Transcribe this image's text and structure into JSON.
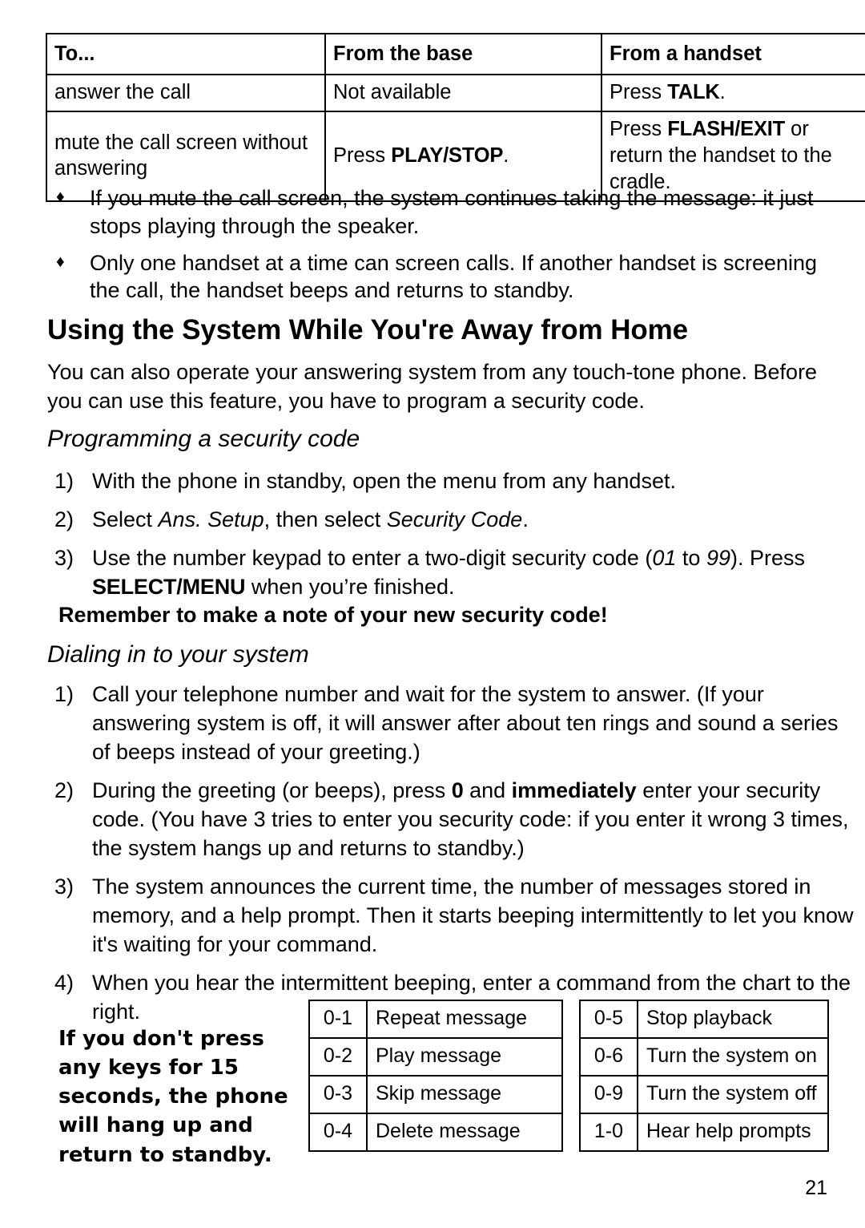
{
  "comparison_table": {
    "headers": [
      "To...",
      "From the base",
      "From a handset"
    ],
    "rows": [
      {
        "task": "answer the call",
        "from_base": "Not available",
        "from_handset_prefix": "Press ",
        "from_handset_key": "TALK",
        "from_handset_suffix": "."
      },
      {
        "task": "mute the call screen without answering",
        "from_base_prefix": "Press ",
        "from_base_key": "PLAY/STOP",
        "from_base_suffix": ".",
        "from_handset_prefix": "Press ",
        "from_handset_key": "FLASH/EXIT",
        "from_handset_suffix": " or return the handset to the cradle."
      }
    ]
  },
  "bullets": {
    "marker": "diamond-bullet",
    "marker_glyph": "♦",
    "items": [
      "If you mute the call screen, the system continues taking the message: it just stops playing through the speaker.",
      "Only one handset at a time can screen calls. If another handset is screening the call, the handset beeps and returns to standby."
    ]
  },
  "section": {
    "heading": "Using the System While You're Away from Home",
    "intro": "You can also operate your answering system from any touch-tone phone. Before you can use this feature, you have to program a security code."
  },
  "programming": {
    "heading": "Programming a security code",
    "steps": [
      {
        "number": "1)",
        "parts": [
          {
            "text": "With the phone in standby, open the menu from any handset.",
            "style": "normal"
          }
        ]
      },
      {
        "number": "2)",
        "parts": [
          {
            "text": "Select ",
            "style": "normal"
          },
          {
            "text": "Ans. Setup",
            "style": "italic"
          },
          {
            "text": ", then select ",
            "style": "normal"
          },
          {
            "text": "Security Code",
            "style": "italic"
          },
          {
            "text": ".",
            "style": "normal"
          }
        ]
      },
      {
        "number": "3)",
        "parts": [
          {
            "text": "Use the number keypad to enter a two-digit security code (",
            "style": "normal"
          },
          {
            "text": "01",
            "style": "italic"
          },
          {
            "text": " to ",
            "style": "normal"
          },
          {
            "text": "99",
            "style": "italic"
          },
          {
            "text": "). Press ",
            "style": "normal"
          },
          {
            "text": "SELECT/MENU",
            "style": "keycap"
          },
          {
            "text": " when you’re finished.",
            "style": "normal"
          }
        ]
      }
    ],
    "note": "Remember to make a note of your new security code!"
  },
  "dialing": {
    "heading": "Dialing in to your system",
    "steps": [
      {
        "number": "1)",
        "parts": [
          {
            "text": "Call your telephone number and wait for the system to answer. (If your answering system is off, it will answer after about ten rings and sound a series of beeps instead of your greeting.)",
            "style": "normal"
          }
        ]
      },
      {
        "number": "2)",
        "parts": [
          {
            "text": "During the greeting (or beeps), press ",
            "style": "normal"
          },
          {
            "text": "0",
            "style": "keycap"
          },
          {
            "text": " and ",
            "style": "normal"
          },
          {
            "text": "immediately",
            "style": "bold"
          },
          {
            "text": " enter your security code. (You have 3 tries to enter you security code: if you enter it wrong 3 times, the system hangs up and returns to standby.)",
            "style": "normal"
          }
        ]
      },
      {
        "number": "3)",
        "parts": [
          {
            "text": "The system announces the current time, the number of messages stored in memory, and a help prompt. Then it starts beeping intermittently to let you know it's waiting for your command.",
            "style": "normal"
          }
        ]
      },
      {
        "number": "4)",
        "parts": [
          {
            "text": "When you hear the intermittent beeping, enter a command from the chart to the right.",
            "style": "normal"
          }
        ]
      }
    ]
  },
  "side_note": "If you don't press any keys for 15 seconds, the phone will hang up and return to standby.",
  "command_table_left": {
    "rows": [
      {
        "code": "0-1",
        "action": "Repeat message"
      },
      {
        "code": "0-2",
        "action": "Play message"
      },
      {
        "code": "0-3",
        "action": "Skip message"
      },
      {
        "code": "0-4",
        "action": "Delete message"
      }
    ]
  },
  "command_table_right": {
    "rows": [
      {
        "code": "0-5",
        "action": "Stop playback"
      },
      {
        "code": "0-6",
        "action": "Turn the system on"
      },
      {
        "code": "0-9",
        "action": "Turn the system off"
      },
      {
        "code": "1-0",
        "action": "Hear help prompts"
      }
    ]
  },
  "page_number": "21"
}
